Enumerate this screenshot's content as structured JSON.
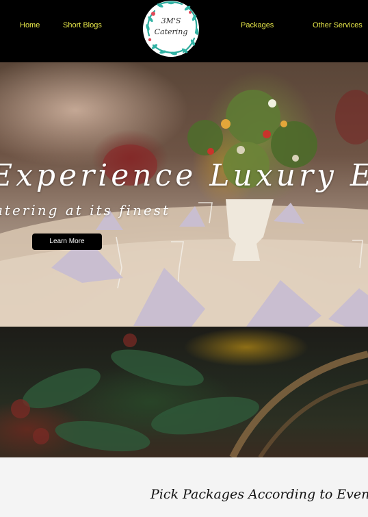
{
  "nav": {
    "home": "Home",
    "short_blogs": "Short Blogs",
    "packages": "Packages",
    "other_services": "Other Services",
    "link_color": "#e8e84a"
  },
  "logo": {
    "line1": "3M'S",
    "line2": "Catering",
    "icon": "floral-wreath-logo"
  },
  "hero": {
    "title": "Experience Luxury Ev",
    "subtitle": "atering at its finest",
    "button_label": "Learn More"
  },
  "section": {
    "title": "Pick Packages According to Events"
  },
  "colors": {
    "header_bg": "#000000",
    "page_bg": "#f4f4f4",
    "button_bg": "#000000"
  }
}
